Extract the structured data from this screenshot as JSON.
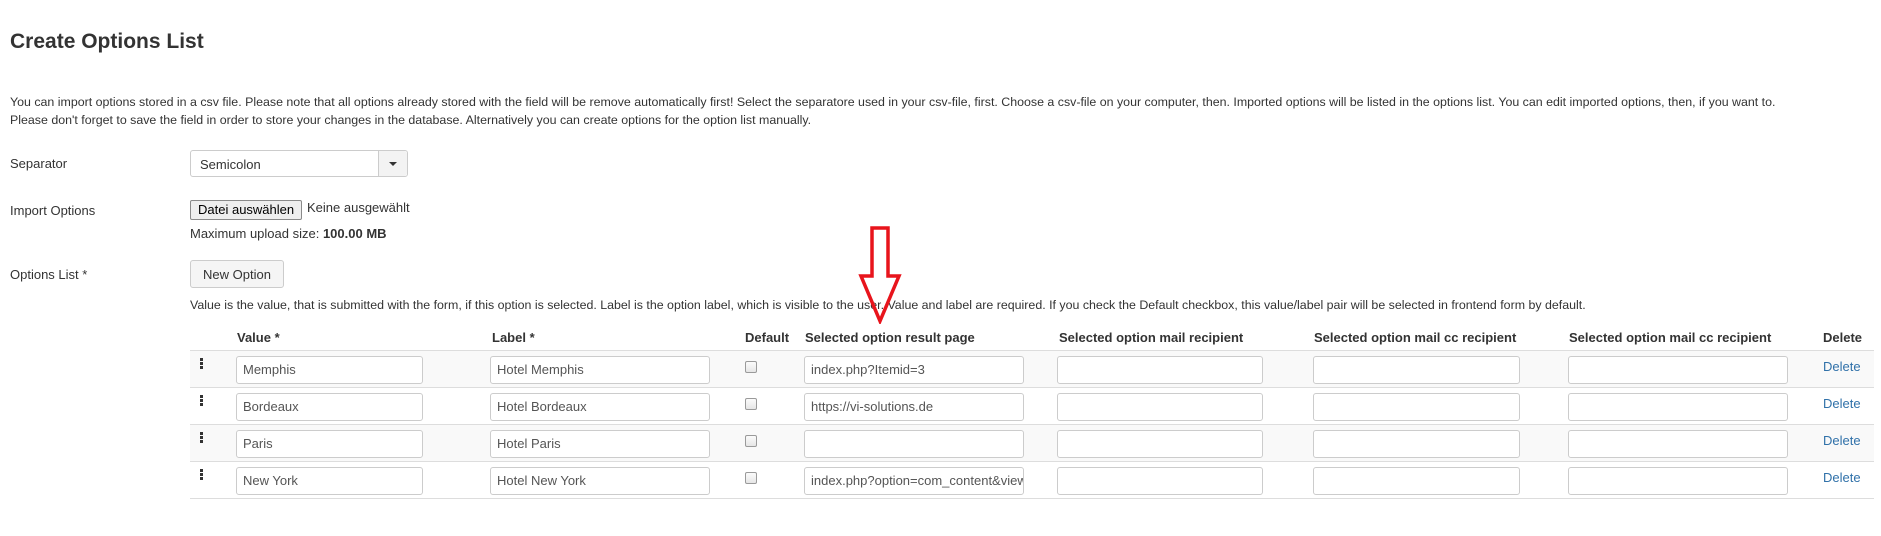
{
  "page": {
    "title": "Create Options List",
    "intro_line1": "You can import options stored in a csv file. Please note that all options already stored with the field will be remove automatically first! Select the separatore used in your csv-file, first. Choose a csv-file on your computer, then. Imported options will be listed in the options list. You can edit imported options, then, if you want to.",
    "intro_line2": "Please don't forget to save the field in order to store your changes in the database. Alternatively you can create options for the option list manually."
  },
  "separator": {
    "label": "Separator",
    "selected": "Semicolon"
  },
  "import": {
    "label": "Import Options",
    "button_label": "Datei auswählen",
    "file_status": "Keine ausgewählt",
    "upload_prefix": "Maximum upload size: ",
    "upload_size": "100.00 MB"
  },
  "options_list": {
    "label": "Options List *",
    "new_option_label": "New Option",
    "help_text": "Value is the value, that is submitted with the form, if this option is selected. Label is the option label, which is visible to the user. Value and label are required. If you check the Default checkbox, this value/label pair will be selected in frontend form by default.",
    "columns": {
      "value": "Value *",
      "label": "Label *",
      "default": "Default",
      "result_page": "Selected option result page",
      "mail_recipient": "Selected option mail recipient",
      "mail_cc_1": "Selected option mail cc recipient",
      "mail_cc_2": "Selected option mail cc recipient",
      "delete": "Delete"
    },
    "rows": [
      {
        "value": "Memphis",
        "label": "Hotel Memphis",
        "default": false,
        "result_page": "index.php?Itemid=3",
        "mail_recipient": "",
        "mail_cc_1": "",
        "mail_cc_2": "",
        "delete_label": "Delete"
      },
      {
        "value": "Bordeaux",
        "label": "Hotel Bordeaux",
        "default": false,
        "result_page": "https://vi-solutions.de",
        "mail_recipient": "",
        "mail_cc_1": "",
        "mail_cc_2": "",
        "delete_label": "Delete"
      },
      {
        "value": "Paris",
        "label": "Hotel Paris",
        "default": false,
        "result_page": "",
        "mail_recipient": "",
        "mail_cc_1": "",
        "mail_cc_2": "",
        "delete_label": "Delete"
      },
      {
        "value": "New York",
        "label": "Hotel New York",
        "default": false,
        "result_page": "index.php?option=com_content&view",
        "mail_recipient": "",
        "mail_cc_1": "",
        "mail_cc_2": "",
        "delete_label": "Delete"
      }
    ]
  },
  "annotation": {
    "icon": "red-down-arrow-icon",
    "color": "#e8141c"
  },
  "colors": {
    "link": "#3071a9",
    "stripe": "#f9f9f9",
    "border": "#dddddd"
  }
}
